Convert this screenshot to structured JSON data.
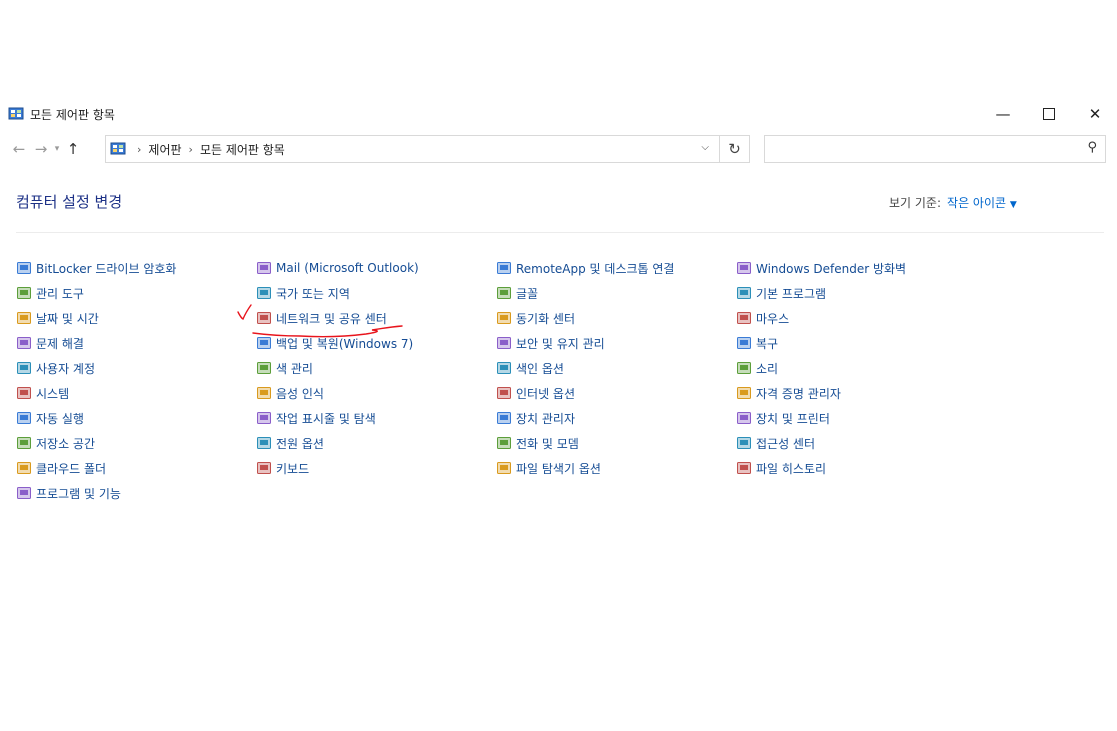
{
  "window": {
    "title": "모든 제어판 항목"
  },
  "address": {
    "crumbs": [
      "제어판",
      "모든 제어판 항목"
    ]
  },
  "search": {
    "placeholder": ""
  },
  "header": {
    "title": "컴퓨터 설정 변경",
    "view_by_label": "보기 기준:",
    "view_by_value": "작은 아이콘"
  },
  "colors": {
    "link": "#154c94",
    "heading": "#1e3287",
    "accent": "#0066cc",
    "annotation": "#e8141c"
  },
  "columns": [
    [
      {
        "label": "BitLocker 드라이브 암호화",
        "icon": "bitlocker-icon"
      },
      {
        "label": "관리 도구",
        "icon": "admin-tools-icon"
      },
      {
        "label": "날짜 및 시간",
        "icon": "date-time-icon"
      },
      {
        "label": "문제 해결",
        "icon": "troubleshoot-icon"
      },
      {
        "label": "사용자 계정",
        "icon": "user-accounts-icon"
      },
      {
        "label": "시스템",
        "icon": "system-icon"
      },
      {
        "label": "자동 실행",
        "icon": "autoplay-icon"
      },
      {
        "label": "저장소 공간",
        "icon": "storage-spaces-icon"
      },
      {
        "label": "클라우드 폴더",
        "icon": "work-folders-icon"
      },
      {
        "label": "프로그램 및 기능",
        "icon": "programs-features-icon"
      }
    ],
    [
      {
        "label": "Mail (Microsoft Outlook)",
        "icon": "mail-icon"
      },
      {
        "label": "국가 또는 지역",
        "icon": "region-icon"
      },
      {
        "label": "네트워크 및 공유 센터",
        "icon": "network-sharing-icon"
      },
      {
        "label": "백업 및 복원(Windows 7)",
        "icon": "backup-restore-icon"
      },
      {
        "label": "색 관리",
        "icon": "color-management-icon"
      },
      {
        "label": "음성 인식",
        "icon": "speech-recognition-icon"
      },
      {
        "label": "작업 표시줄 및 탐색",
        "icon": "taskbar-icon"
      },
      {
        "label": "전원 옵션",
        "icon": "power-options-icon"
      },
      {
        "label": "키보드",
        "icon": "keyboard-icon"
      }
    ],
    [
      {
        "label": "RemoteApp 및 데스크톱 연결",
        "icon": "remoteapp-icon"
      },
      {
        "label": "글꼴",
        "icon": "fonts-icon"
      },
      {
        "label": "동기화 센터",
        "icon": "sync-center-icon"
      },
      {
        "label": "보안 및 유지 관리",
        "icon": "security-maintenance-icon"
      },
      {
        "label": "색인 옵션",
        "icon": "indexing-options-icon"
      },
      {
        "label": "인터넷 옵션",
        "icon": "internet-options-icon"
      },
      {
        "label": "장치 관리자",
        "icon": "device-manager-icon"
      },
      {
        "label": "전화 및 모뎀",
        "icon": "phone-modem-icon"
      },
      {
        "label": "파일 탐색기 옵션",
        "icon": "file-explorer-options-icon"
      }
    ],
    [
      {
        "label": "Windows Defender 방화벽",
        "icon": "firewall-icon"
      },
      {
        "label": "기본 프로그램",
        "icon": "default-programs-icon"
      },
      {
        "label": "마우스",
        "icon": "mouse-icon"
      },
      {
        "label": "복구",
        "icon": "recovery-icon"
      },
      {
        "label": "소리",
        "icon": "sound-icon"
      },
      {
        "label": "자격 증명 관리자",
        "icon": "credential-manager-icon"
      },
      {
        "label": "장치 및 프린터",
        "icon": "devices-printers-icon"
      },
      {
        "label": "접근성 센터",
        "icon": "ease-of-access-icon"
      },
      {
        "label": "파일 히스토리",
        "icon": "file-history-icon"
      }
    ]
  ]
}
